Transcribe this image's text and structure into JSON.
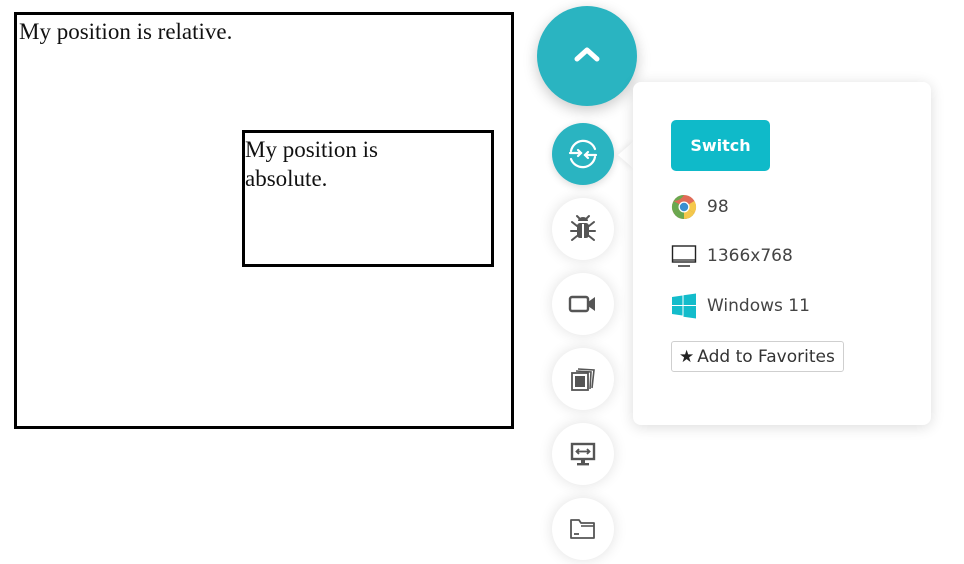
{
  "demo": {
    "relative_text": "My position is relative.",
    "absolute_text": "My position is absolute."
  },
  "toolbar": {
    "accent_color": "#2ab4c1",
    "collapse_icon": "chevron-up-icon",
    "buttons": [
      {
        "name": "switch-browser",
        "icon": "switch-arrows-icon",
        "active": true
      },
      {
        "name": "bug-report",
        "icon": "bug-icon",
        "active": false
      },
      {
        "name": "record-video",
        "icon": "video-camera-icon",
        "active": false
      },
      {
        "name": "screenshots",
        "icon": "gallery-icon",
        "active": false
      },
      {
        "name": "resolution",
        "icon": "monitor-resize-icon",
        "active": false
      },
      {
        "name": "files",
        "icon": "folder-icon",
        "active": false
      }
    ]
  },
  "panel": {
    "switch_label": "Switch",
    "switch_color": "#0fbac9",
    "browser_icon": "chrome-icon",
    "browser_version": "98",
    "resolution_icon": "monitor-icon",
    "resolution": "1366x768",
    "os_icon": "windows-icon",
    "os": "Windows 11",
    "favorites_icon": "star-icon",
    "favorites_label": "Add to Favorites"
  }
}
